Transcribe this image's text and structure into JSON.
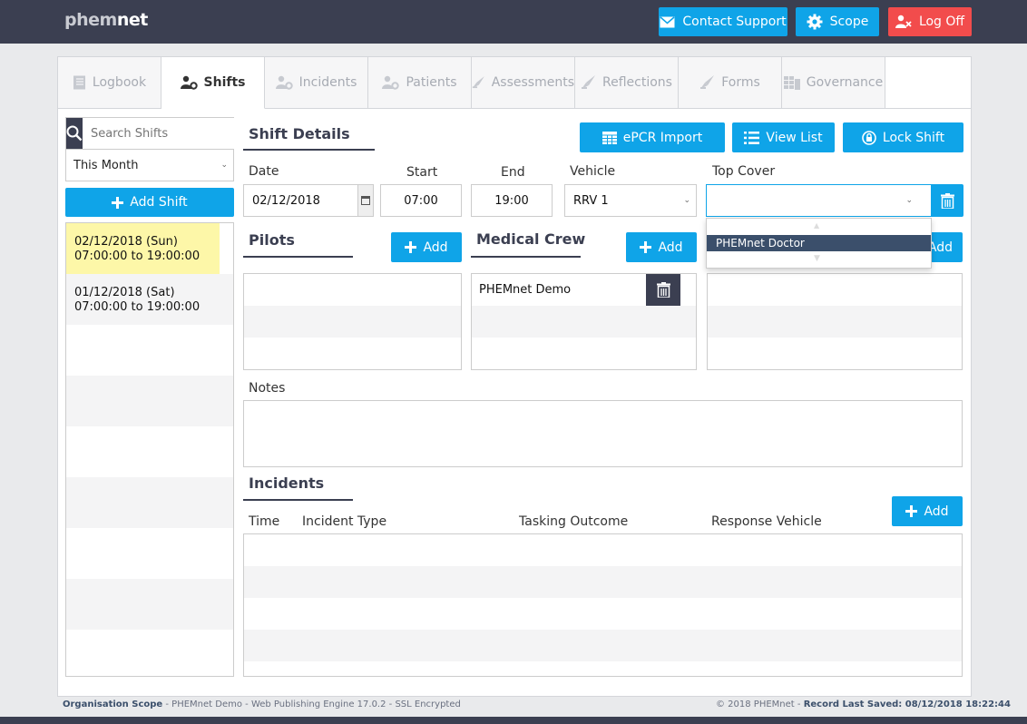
{
  "app": {
    "logo_light": "phem",
    "logo_bold": "net"
  },
  "header": {
    "contact_support": "Contact Support",
    "scope": "Scope",
    "log_off": "Log Off"
  },
  "tabs": [
    {
      "label": "Logbook",
      "icon": "book-icon"
    },
    {
      "label": "Shifts",
      "icon": "users-gear-icon"
    },
    {
      "label": "Incidents",
      "icon": "users-gear-icon"
    },
    {
      "label": "Patients",
      "icon": "users-gear-icon"
    },
    {
      "label": "Assessments",
      "icon": "rocket-icon"
    },
    {
      "label": "Reflections",
      "icon": "rocket-icon"
    },
    {
      "label": "Forms",
      "icon": "rocket-icon"
    },
    {
      "label": "Governance",
      "icon": "grid-icon"
    }
  ],
  "sidebar": {
    "search_placeholder": "Search Shifts",
    "filter": "This Month",
    "add_shift": "Add Shift",
    "shifts": [
      {
        "date": "02/12/2018 (Sun)",
        "time": "07:00:00 to 19:00:00"
      },
      {
        "date": "01/12/2018 (Sat)",
        "time": "07:00:00 to 19:00:00"
      }
    ]
  },
  "shift_details": {
    "title": "Shift Details",
    "epcr_import": "ePCR Import",
    "view_list": "View List",
    "lock_shift": "Lock Shift",
    "date_label": "Date",
    "date_value": "02/12/2018",
    "start_label": "Start",
    "start_value": "07:00",
    "end_label": "End",
    "end_value": "19:00",
    "vehicle_label": "Vehicle",
    "vehicle_value": "RRV 1",
    "top_cover_label": "Top Cover",
    "top_cover_value": "",
    "top_cover_options": [
      "PHEMnet Doctor"
    ]
  },
  "pilots": {
    "title": "Pilots",
    "add": "Add"
  },
  "medical_crew": {
    "title": "Medical Crew",
    "add": "Add",
    "members": [
      "PHEMnet Demo"
    ]
  },
  "third": {
    "add": "Add"
  },
  "notes": {
    "label": "Notes",
    "value": ""
  },
  "incidents": {
    "title": "Incidents",
    "add": "Add",
    "columns": [
      "Time",
      "Incident Type",
      "Tasking Outcome",
      "Response Vehicle"
    ]
  },
  "footer": {
    "left_bold": "Organisation Scope",
    "left_rest": " - PHEMnet Demo - Web Publishing Engine 17.0.2 - SSL Encrypted",
    "right_prefix": "© 2018 PHEMnet - ",
    "right_bold": "Record Last Saved: 08/12/2018 18:22:44"
  },
  "colors": {
    "primary": "#0fa4e8",
    "danger": "#f24c4c",
    "dark": "#3b3f51",
    "selected_row": "#fdf7a8"
  }
}
